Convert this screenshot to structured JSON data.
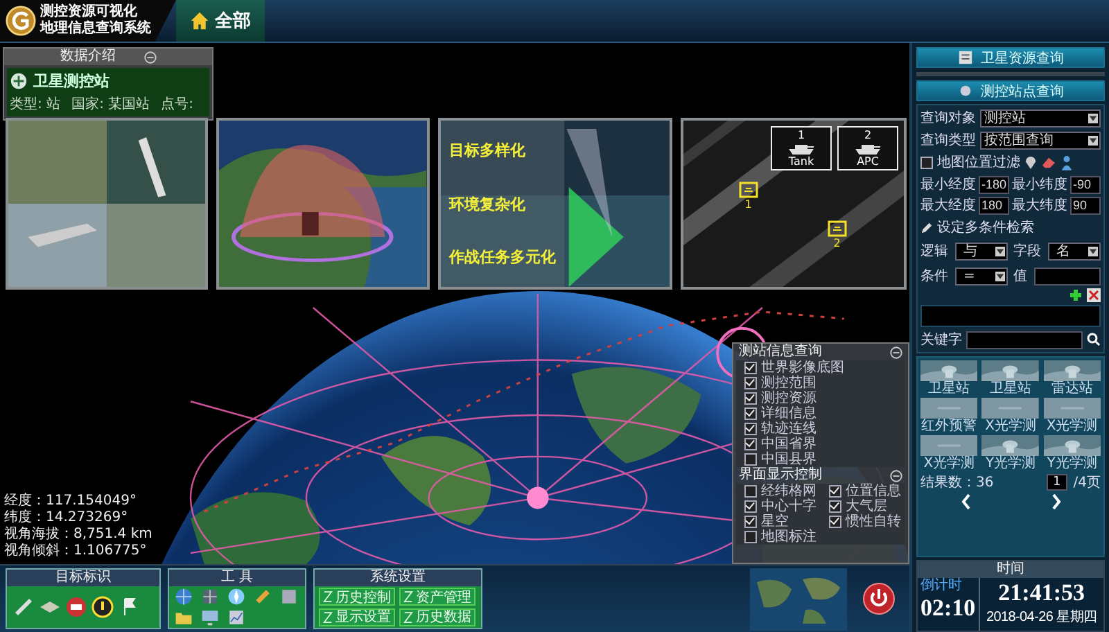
{
  "header": {
    "title_lines": [
      "测控资源可视化",
      "地理信息查询系统"
    ],
    "tabs": [
      {
        "label": "全部",
        "selected": true
      }
    ]
  },
  "info_card": {
    "title": "数据介绍",
    "name": "卫星测控站",
    "fields": [
      "类型: 站",
      "国家: 某国站",
      "点号:"
    ]
  },
  "thumbnails": [
    {
      "kind": "quad"
    },
    {
      "kind": "dome"
    },
    {
      "kind": "sea",
      "captions": [
        "目标多样化",
        "环境复杂化",
        "作战任务多元化"
      ]
    },
    {
      "kind": "sar",
      "targets": [
        {
          "number": "1",
          "class": "Tank"
        },
        {
          "number": "2",
          "class": "APC"
        }
      ],
      "markers": [
        "1",
        "2"
      ]
    }
  ],
  "coords": [
    "经度：117.154049°",
    "纬度：14.273269°",
    "视角海拔：8,751.4 km",
    "视角倾斜：1.106775°"
  ],
  "layer_panel": [
    {
      "title": "测站信息查询",
      "kind": "list",
      "items": [
        {
          "label": "世界影像底图",
          "checked": true
        },
        {
          "label": "测控范围",
          "checked": true
        },
        {
          "label": "测控资源",
          "checked": true
        },
        {
          "label": "详细信息",
          "checked": true
        },
        {
          "label": "轨迹连线",
          "checked": true
        },
        {
          "label": "中国省界",
          "checked": true
        },
        {
          "label": "中国县界",
          "checked": false
        }
      ]
    },
    {
      "title": "界面显示控制",
      "kind": "grid",
      "items": [
        {
          "label": "经纬格网",
          "checked": false
        },
        {
          "label": "位置信息",
          "checked": true
        },
        {
          "label": "中心十字",
          "checked": true
        },
        {
          "label": "大气层",
          "checked": true
        },
        {
          "label": "星空",
          "checked": true
        },
        {
          "label": "惯性自转",
          "checked": true
        },
        {
          "label": "地图标注",
          "checked": false
        }
      ]
    }
  ],
  "toolbar": [
    {
      "title": "目标标识",
      "kind": "icons"
    },
    {
      "title": "工 具",
      "kind": "tools"
    },
    {
      "title": "系统设置",
      "kind": "buttons",
      "buttons": [
        "历史控制",
        "资产管理",
        "显示设置",
        "历史数据"
      ]
    }
  ],
  "side": {
    "buttons": [
      "卫星资源查询",
      "测控站点查询"
    ],
    "selects": [
      {
        "label": "查询对象",
        "value": "测控站"
      },
      {
        "label": "查询类型",
        "value": "按范围查询"
      }
    ],
    "filter": {
      "label": "地图位置过滤",
      "checked": false
    },
    "bounds": [
      {
        "label": "最小经度",
        "value": "-180"
      },
      {
        "label": "最小纬度",
        "value": "-90"
      },
      {
        "label": "最大经度",
        "value": "180"
      },
      {
        "label": "最大纬度",
        "value": "90"
      }
    ],
    "condition_link": "设定多条件检索",
    "conditions": [
      {
        "kind": "select",
        "label": "逻辑",
        "value": "与"
      },
      {
        "kind": "select",
        "label": "字段",
        "value": "名"
      },
      {
        "kind": "select",
        "label": "条件",
        "value": "="
      },
      {
        "kind": "input",
        "label": "值"
      }
    ],
    "keyword": {
      "label": "关键字"
    },
    "gallery": [
      {
        "caption": "卫星站"
      },
      {
        "caption": "卫星站"
      },
      {
        "caption": "雷达站"
      },
      {
        "kind": "blank",
        "caption": "红外预警"
      },
      {
        "kind": "blank",
        "caption": "X光学测"
      },
      {
        "kind": "blank",
        "caption": "X光学测"
      },
      {
        "kind": "blank",
        "caption": "X光学测"
      },
      {
        "caption": "Y光学测"
      },
      {
        "caption": "Y光学测"
      }
    ],
    "results": "结果数：36",
    "page": "1",
    "pages": "/4页"
  },
  "clock": {
    "title": "时间",
    "label": "倒计时",
    "countdown": "02:10",
    "time": "21:41:53",
    "date": "2018-04-26 星期四"
  }
}
